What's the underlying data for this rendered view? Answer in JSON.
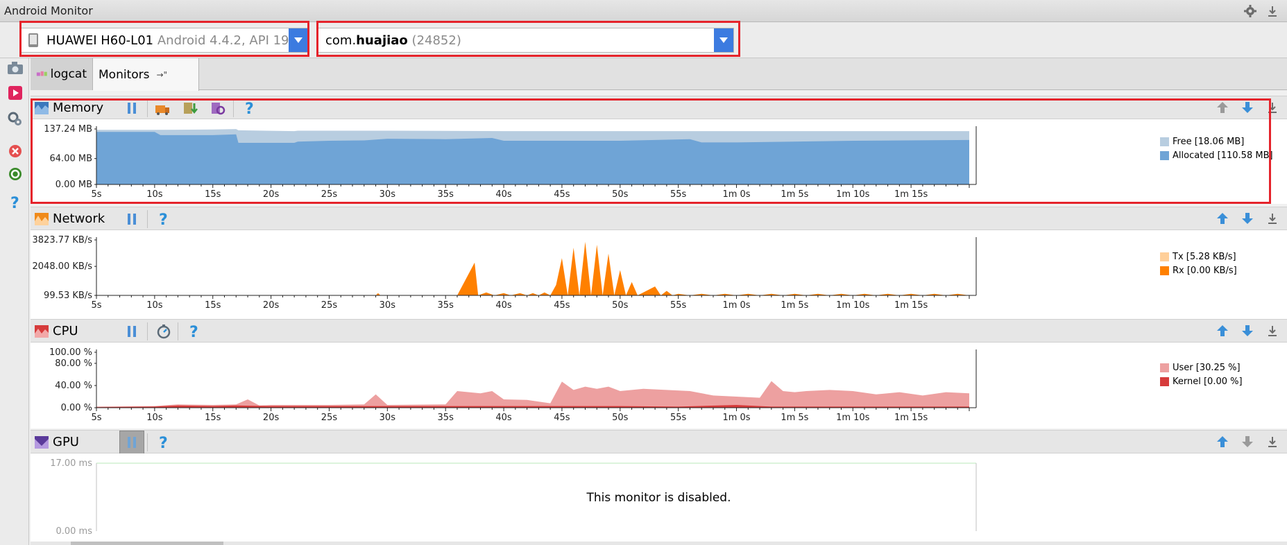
{
  "window": {
    "title": "Android Monitor"
  },
  "device_selector": {
    "device_name": "HUAWEI H60-L01",
    "device_os": "Android 4.4.2, API 19"
  },
  "process_selector": {
    "prefix": "com.",
    "bold": "huajiao",
    "pid": "(24852)"
  },
  "tabs": [
    {
      "label": "logcat",
      "active": false
    },
    {
      "label": "Monitors",
      "active": true,
      "suffix": "→\""
    }
  ],
  "panels": {
    "memory": {
      "title": "Memory"
    },
    "network": {
      "title": "Network"
    },
    "cpu": {
      "title": "CPU"
    },
    "gpu": {
      "title": "GPU",
      "disabled_message": "This monitor is disabled."
    }
  },
  "colors": {
    "accent": "#3c7be0",
    "highlight": "#e5232b",
    "memory_free": "#b8cde0",
    "memory_allocated": "#6fa4d6",
    "network_tx": "#ffcf99",
    "network_rx": "#ff8000",
    "cpu_user": "#eda0a0",
    "cpu_kernel": "#d63b3b",
    "gpu_border": "#b9e8b9"
  },
  "icons": {
    "title_settings": "gear-icon",
    "title_hide": "minimize-icon",
    "screenshot": "camera-icon",
    "record": "record-icon",
    "system_info": "system-info-icon",
    "terminate": "terminate-app-icon",
    "gc": "gc-icon",
    "help": "help-icon"
  },
  "chart_data": [
    {
      "type": "area",
      "panel": "Memory",
      "x_ticks": [
        "5s",
        "10s",
        "15s",
        "20s",
        "25s",
        "30s",
        "35s",
        "40s",
        "45s",
        "50s",
        "55s",
        "1m 0s",
        "1m 5s",
        "1m 10s",
        "1m 15s"
      ],
      "y_ticks": [
        "137.24 MB",
        "64.00 MB",
        "0.00 MB"
      ],
      "ylim": [
        0,
        137.24
      ],
      "legend": [
        "Free [18.06 MB]",
        "Allocated [110.58 MB]"
      ],
      "series": [
        {
          "name": "Free",
          "x": [
            5,
            10,
            15,
            17,
            17.2,
            22,
            22.3,
            30,
            40,
            50,
            60,
            70,
            80
          ],
          "values": [
            135,
            135,
            136,
            137,
            134,
            132,
            133,
            133,
            132,
            132,
            132,
            132,
            132
          ]
        },
        {
          "name": "Allocated",
          "x": [
            5,
            10,
            10.5,
            15,
            17,
            17.2,
            22,
            22.3,
            25,
            28,
            30,
            35,
            39,
            40,
            50,
            56,
            57,
            60,
            70,
            80
          ],
          "values": [
            130,
            130,
            122,
            122,
            124,
            103,
            103,
            106,
            108,
            109,
            113,
            112,
            115,
            108,
            108,
            112,
            104,
            104,
            108,
            110
          ]
        }
      ]
    },
    {
      "type": "area",
      "panel": "Network",
      "x_ticks": [
        "5s",
        "10s",
        "15s",
        "20s",
        "25s",
        "30s",
        "35s",
        "40s",
        "45s",
        "50s",
        "55s",
        "1m 0s",
        "1m 5s",
        "1m 10s",
        "1m 15s"
      ],
      "y_ticks": [
        "3823.77 KB/s",
        "2048.00 KB/s",
        "99.53 KB/s"
      ],
      "ylim": [
        99.53,
        3823.77
      ],
      "legend": [
        "Tx [5.28 KB/s]",
        "Rx [0.00 KB/s]"
      ],
      "series": [
        {
          "name": "Rx",
          "x": [
            5,
            29,
            29.2,
            29.4,
            36,
            37.5,
            37.8,
            38.5,
            39.2,
            40,
            40.6,
            41.4,
            42,
            42.5,
            43,
            43.5,
            44,
            44.5,
            45,
            45.5,
            46,
            46.5,
            47,
            47.5,
            48,
            48.5,
            49,
            49.5,
            50,
            50.5,
            51,
            51.5,
            52,
            53,
            53.5,
            54,
            54.5,
            55,
            56,
            57,
            58,
            59,
            60,
            61,
            62,
            63,
            64,
            65,
            66,
            67,
            68,
            69,
            70,
            71,
            72,
            73,
            74,
            75,
            76,
            77,
            78,
            79,
            80
          ],
          "values": [
            100,
            100,
            250,
            100,
            100,
            2300,
            100,
            300,
            100,
            250,
            100,
            250,
            100,
            250,
            100,
            300,
            100,
            800,
            2600,
            100,
            3300,
            100,
            3700,
            100,
            3500,
            100,
            2900,
            100,
            1800,
            100,
            1000,
            100,
            300,
            700,
            100,
            400,
            100,
            200,
            100,
            200,
            100,
            200,
            100,
            200,
            100,
            200,
            100,
            200,
            100,
            200,
            100,
            200,
            100,
            200,
            100,
            200,
            100,
            200,
            100,
            200,
            100,
            200,
            100
          ]
        }
      ]
    },
    {
      "type": "area",
      "panel": "CPU",
      "x_ticks": [
        "5s",
        "10s",
        "15s",
        "20s",
        "25s",
        "30s",
        "35s",
        "40s",
        "45s",
        "50s",
        "55s",
        "1m 0s",
        "1m 5s",
        "1m 10s",
        "1m 15s"
      ],
      "y_ticks": [
        "100.00 %",
        "80.00 %",
        "40.00 %",
        "0.00 %"
      ],
      "ylim": [
        0,
        100
      ],
      "legend": [
        "User [30.25 %]",
        "Kernel [0.00 %]"
      ],
      "series": [
        {
          "name": "User",
          "x": [
            5,
            10,
            12,
            15,
            17,
            18,
            19,
            20,
            25,
            28,
            29,
            30,
            35,
            36,
            38,
            39,
            40,
            42,
            44,
            45,
            46,
            47,
            48,
            49,
            50,
            52,
            54,
            56,
            58,
            60,
            62,
            63,
            64,
            65,
            66,
            68,
            70,
            72,
            74,
            76,
            78,
            80
          ],
          "values": [
            2,
            3,
            6,
            5,
            6,
            15,
            4,
            5,
            5,
            6,
            24,
            5,
            6,
            30,
            26,
            30,
            15,
            14,
            8,
            47,
            32,
            38,
            34,
            38,
            30,
            34,
            32,
            30,
            22,
            20,
            18,
            48,
            30,
            28,
            30,
            32,
            30,
            24,
            28,
            22,
            28,
            26
          ]
        },
        {
          "name": "Kernel",
          "x": [
            5,
            10,
            12,
            15,
            17,
            20,
            25,
            30,
            35,
            40,
            45,
            50,
            55,
            60,
            62,
            63,
            65,
            70,
            75,
            80
          ],
          "values": [
            1,
            2,
            4,
            3,
            4,
            3,
            3,
            3,
            3,
            3,
            3,
            3,
            2,
            5,
            3,
            2,
            2,
            2,
            2,
            2
          ]
        }
      ]
    },
    {
      "type": "line",
      "panel": "GPU",
      "y_ticks": [
        "17.00 ms",
        "0.00 ms"
      ],
      "ylim": [
        0,
        17
      ]
    }
  ]
}
